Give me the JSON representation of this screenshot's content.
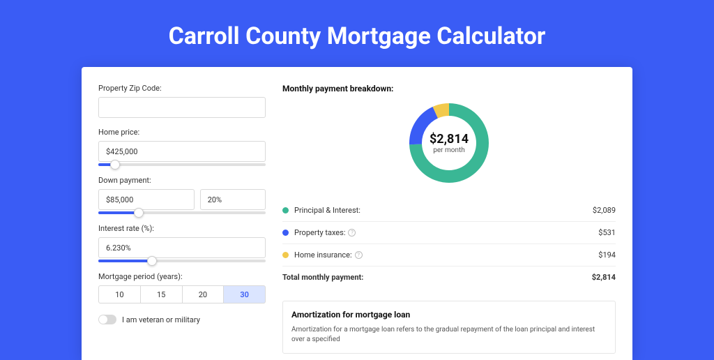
{
  "page_title": "Carroll County Mortgage Calculator",
  "left": {
    "zip": {
      "label": "Property Zip Code:",
      "value": ""
    },
    "home_price": {
      "label": "Home price:",
      "value": "$425,000",
      "slider_pct": 10
    },
    "down_payment": {
      "label": "Down payment:",
      "amount": "$85,000",
      "pct": "20%",
      "slider_pct": 24
    },
    "interest": {
      "label": "Interest rate (%):",
      "value": "6.230%",
      "slider_pct": 32
    },
    "period": {
      "label": "Mortgage period (years):",
      "options": [
        "10",
        "15",
        "20",
        "30"
      ],
      "active": 3
    },
    "veteran": {
      "label": "I am veteran or military",
      "on": false
    }
  },
  "right": {
    "title": "Monthly payment breakdown:",
    "donut": {
      "amount": "$2,814",
      "sub": "per month"
    },
    "legend": [
      {
        "color": "#3ab795",
        "label": "Principal & Interest:",
        "value": "$2,089",
        "info": false
      },
      {
        "color": "#3a5cf5",
        "label": "Property taxes:",
        "value": "$531",
        "info": true
      },
      {
        "color": "#f2c94c",
        "label": "Home insurance:",
        "value": "$194",
        "info": true
      }
    ],
    "total": {
      "label": "Total monthly payment:",
      "value": "$2,814"
    },
    "amort": {
      "title": "Amortization for mortgage loan",
      "text": "Amortization for a mortgage loan refers to the gradual repayment of the loan principal and interest over a specified"
    }
  },
  "chart_data": {
    "type": "pie",
    "title": "Monthly payment breakdown",
    "series": [
      {
        "name": "Principal & Interest",
        "value": 2089,
        "color": "#3ab795"
      },
      {
        "name": "Property taxes",
        "value": 531,
        "color": "#3a5cf5"
      },
      {
        "name": "Home insurance",
        "value": 194,
        "color": "#f2c94c"
      }
    ],
    "total": 2814
  }
}
